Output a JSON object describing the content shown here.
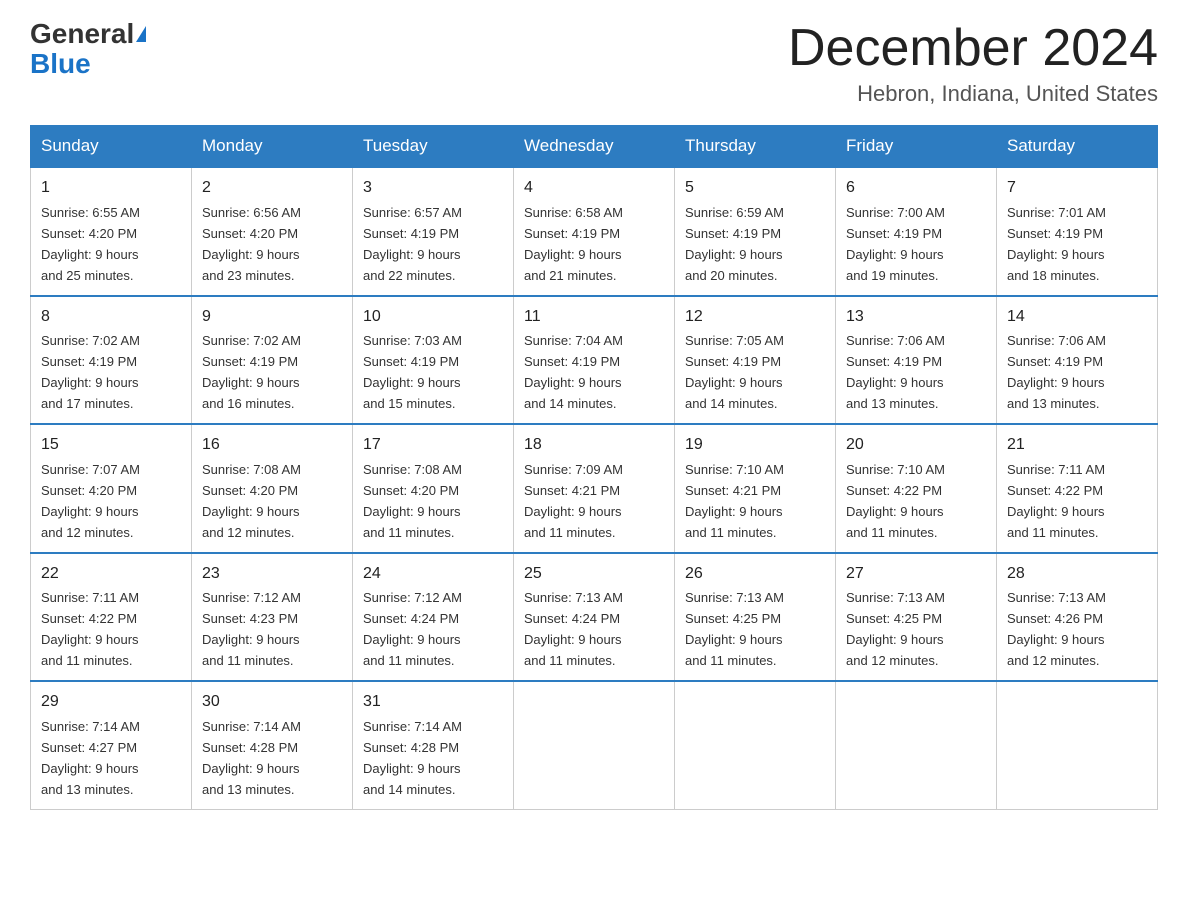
{
  "header": {
    "logo_general": "General",
    "logo_blue": "Blue",
    "month_title": "December 2024",
    "location": "Hebron, Indiana, United States"
  },
  "weekdays": [
    "Sunday",
    "Monday",
    "Tuesday",
    "Wednesday",
    "Thursday",
    "Friday",
    "Saturday"
  ],
  "weeks": [
    [
      {
        "num": "1",
        "sunrise": "6:55 AM",
        "sunset": "4:20 PM",
        "daylight": "9 hours and 25 minutes."
      },
      {
        "num": "2",
        "sunrise": "6:56 AM",
        "sunset": "4:20 PM",
        "daylight": "9 hours and 23 minutes."
      },
      {
        "num": "3",
        "sunrise": "6:57 AM",
        "sunset": "4:19 PM",
        "daylight": "9 hours and 22 minutes."
      },
      {
        "num": "4",
        "sunrise": "6:58 AM",
        "sunset": "4:19 PM",
        "daylight": "9 hours and 21 minutes."
      },
      {
        "num": "5",
        "sunrise": "6:59 AM",
        "sunset": "4:19 PM",
        "daylight": "9 hours and 20 minutes."
      },
      {
        "num": "6",
        "sunrise": "7:00 AM",
        "sunset": "4:19 PM",
        "daylight": "9 hours and 19 minutes."
      },
      {
        "num": "7",
        "sunrise": "7:01 AM",
        "sunset": "4:19 PM",
        "daylight": "9 hours and 18 minutes."
      }
    ],
    [
      {
        "num": "8",
        "sunrise": "7:02 AM",
        "sunset": "4:19 PM",
        "daylight": "9 hours and 17 minutes."
      },
      {
        "num": "9",
        "sunrise": "7:02 AM",
        "sunset": "4:19 PM",
        "daylight": "9 hours and 16 minutes."
      },
      {
        "num": "10",
        "sunrise": "7:03 AM",
        "sunset": "4:19 PM",
        "daylight": "9 hours and 15 minutes."
      },
      {
        "num": "11",
        "sunrise": "7:04 AM",
        "sunset": "4:19 PM",
        "daylight": "9 hours and 14 minutes."
      },
      {
        "num": "12",
        "sunrise": "7:05 AM",
        "sunset": "4:19 PM",
        "daylight": "9 hours and 14 minutes."
      },
      {
        "num": "13",
        "sunrise": "7:06 AM",
        "sunset": "4:19 PM",
        "daylight": "9 hours and 13 minutes."
      },
      {
        "num": "14",
        "sunrise": "7:06 AM",
        "sunset": "4:19 PM",
        "daylight": "9 hours and 13 minutes."
      }
    ],
    [
      {
        "num": "15",
        "sunrise": "7:07 AM",
        "sunset": "4:20 PM",
        "daylight": "9 hours and 12 minutes."
      },
      {
        "num": "16",
        "sunrise": "7:08 AM",
        "sunset": "4:20 PM",
        "daylight": "9 hours and 12 minutes."
      },
      {
        "num": "17",
        "sunrise": "7:08 AM",
        "sunset": "4:20 PM",
        "daylight": "9 hours and 11 minutes."
      },
      {
        "num": "18",
        "sunrise": "7:09 AM",
        "sunset": "4:21 PM",
        "daylight": "9 hours and 11 minutes."
      },
      {
        "num": "19",
        "sunrise": "7:10 AM",
        "sunset": "4:21 PM",
        "daylight": "9 hours and 11 minutes."
      },
      {
        "num": "20",
        "sunrise": "7:10 AM",
        "sunset": "4:22 PM",
        "daylight": "9 hours and 11 minutes."
      },
      {
        "num": "21",
        "sunrise": "7:11 AM",
        "sunset": "4:22 PM",
        "daylight": "9 hours and 11 minutes."
      }
    ],
    [
      {
        "num": "22",
        "sunrise": "7:11 AM",
        "sunset": "4:22 PM",
        "daylight": "9 hours and 11 minutes."
      },
      {
        "num": "23",
        "sunrise": "7:12 AM",
        "sunset": "4:23 PM",
        "daylight": "9 hours and 11 minutes."
      },
      {
        "num": "24",
        "sunrise": "7:12 AM",
        "sunset": "4:24 PM",
        "daylight": "9 hours and 11 minutes."
      },
      {
        "num": "25",
        "sunrise": "7:13 AM",
        "sunset": "4:24 PM",
        "daylight": "9 hours and 11 minutes."
      },
      {
        "num": "26",
        "sunrise": "7:13 AM",
        "sunset": "4:25 PM",
        "daylight": "9 hours and 11 minutes."
      },
      {
        "num": "27",
        "sunrise": "7:13 AM",
        "sunset": "4:25 PM",
        "daylight": "9 hours and 12 minutes."
      },
      {
        "num": "28",
        "sunrise": "7:13 AM",
        "sunset": "4:26 PM",
        "daylight": "9 hours and 12 minutes."
      }
    ],
    [
      {
        "num": "29",
        "sunrise": "7:14 AM",
        "sunset": "4:27 PM",
        "daylight": "9 hours and 13 minutes."
      },
      {
        "num": "30",
        "sunrise": "7:14 AM",
        "sunset": "4:28 PM",
        "daylight": "9 hours and 13 minutes."
      },
      {
        "num": "31",
        "sunrise": "7:14 AM",
        "sunset": "4:28 PM",
        "daylight": "9 hours and 14 minutes."
      },
      null,
      null,
      null,
      null
    ]
  ],
  "labels": {
    "sunrise": "Sunrise:",
    "sunset": "Sunset:",
    "daylight": "Daylight:"
  }
}
